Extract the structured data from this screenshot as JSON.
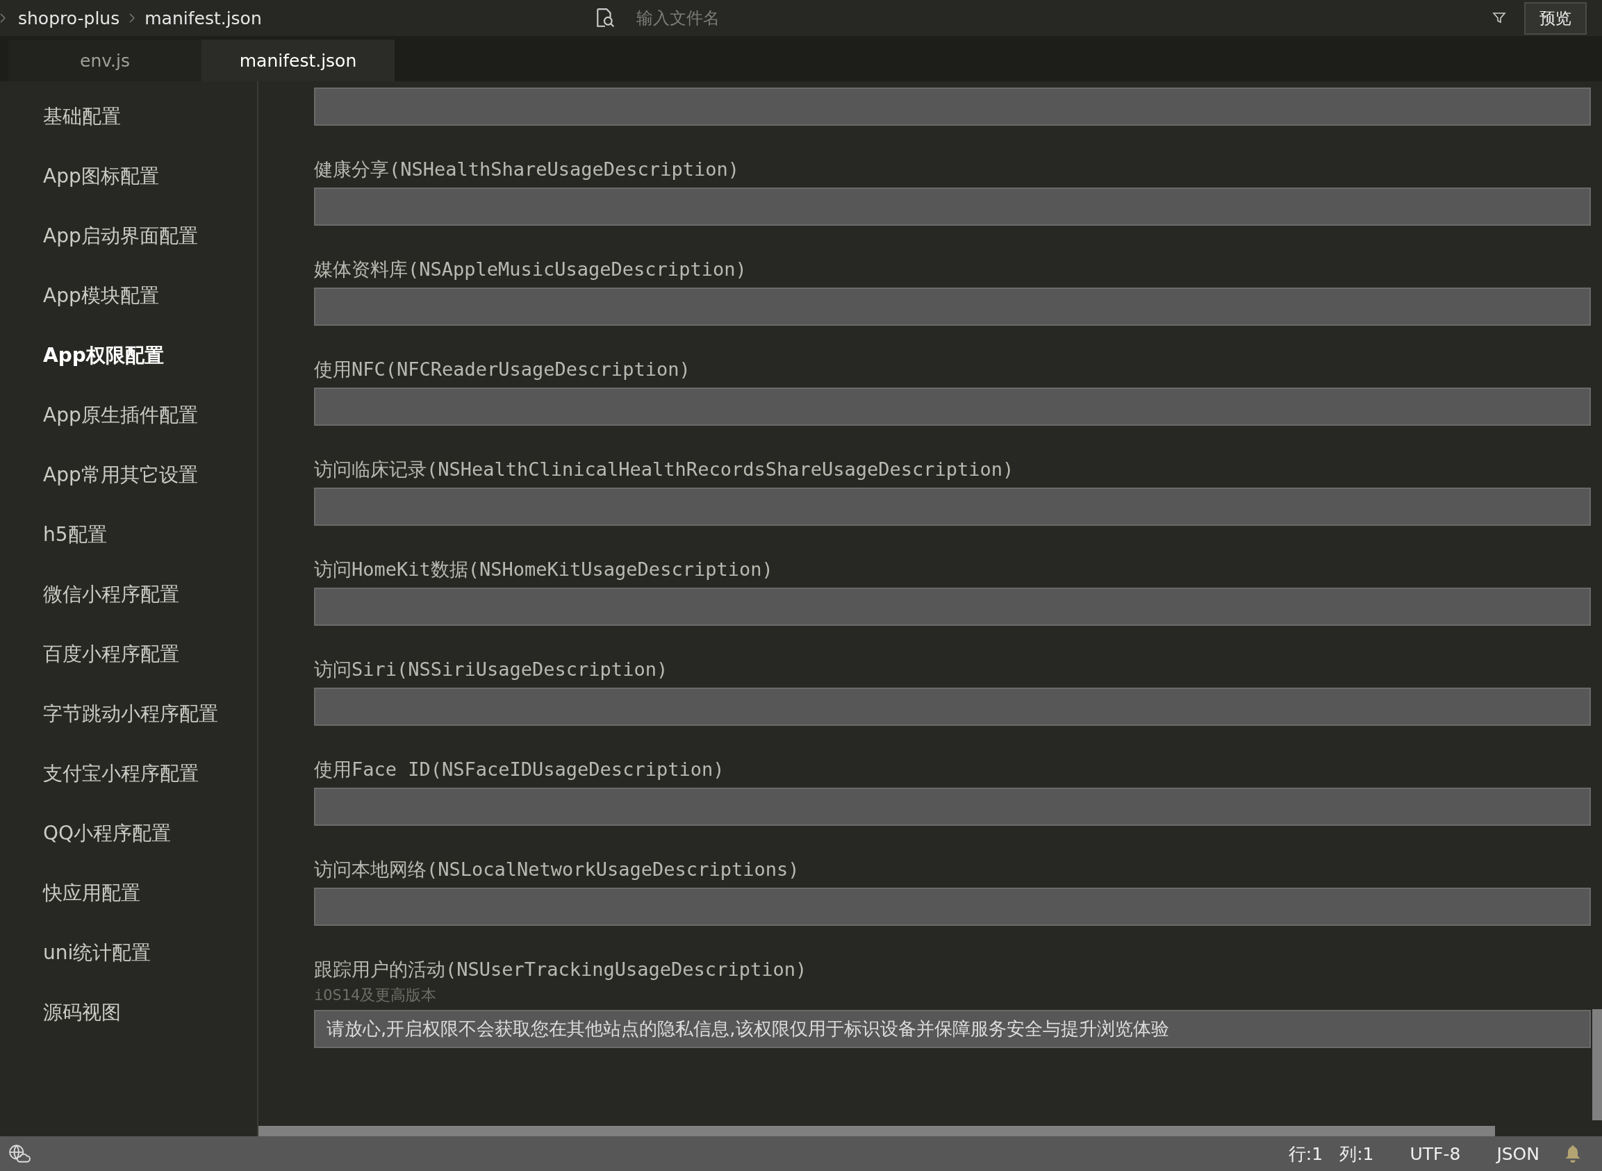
{
  "breadcrumb": [
    "shopro-plus",
    "manifest.json"
  ],
  "search": {
    "placeholder": "输入文件名"
  },
  "preview_button": "预览",
  "tabs": [
    {
      "label": "env.js",
      "selected": false
    },
    {
      "label": "manifest.json",
      "selected": true
    }
  ],
  "sidebar": {
    "items": [
      {
        "label": "基础配置",
        "selected": false
      },
      {
        "label": "App图标配置",
        "selected": false
      },
      {
        "label": "App启动界面配置",
        "selected": false
      },
      {
        "label": "App模块配置",
        "selected": false
      },
      {
        "label": "App权限配置",
        "selected": true
      },
      {
        "label": "App原生插件配置",
        "selected": false
      },
      {
        "label": "App常用其它设置",
        "selected": false
      },
      {
        "label": "h5配置",
        "selected": false
      },
      {
        "label": "微信小程序配置",
        "selected": false
      },
      {
        "label": "百度小程序配置",
        "selected": false
      },
      {
        "label": "字节跳动小程序配置",
        "selected": false
      },
      {
        "label": "支付宝小程序配置",
        "selected": false
      },
      {
        "label": "QQ小程序配置",
        "selected": false
      },
      {
        "label": "快应用配置",
        "selected": false
      },
      {
        "label": "uni统计配置",
        "selected": false
      },
      {
        "label": "源码视图",
        "selected": false
      }
    ]
  },
  "fields": [
    {
      "kind": "cut"
    },
    {
      "label": "健康分享(NSHealthShareUsageDescription)"
    },
    {
      "label": "媒体资料库(NSAppleMusicUsageDescription)"
    },
    {
      "label": "使用NFC(NFCReaderUsageDescription)"
    },
    {
      "label": "访问临床记录(NSHealthClinicalHealthRecordsShareUsageDescription)"
    },
    {
      "label": "访问HomeKit数据(NSHomeKitUsageDescription)"
    },
    {
      "label": "访问Siri(NSSiriUsageDescription)"
    },
    {
      "label": "使用Face ID(NSFaceIDUsageDescription)"
    },
    {
      "label": "访问本地网络(NSLocalNetworkUsageDescriptions)"
    },
    {
      "label": "跟踪用户的活动(NSUserTrackingUsageDescription)",
      "hint": "iOS14及更高版本",
      "value": "请放心,开启权限不会获取您在其他站点的隐私信息,该权限仅用于标识设备并保障服务安全与提升浏览体验"
    }
  ],
  "status_bar": {
    "position": [
      "行:1",
      "列:1"
    ],
    "encoding": "UTF-8",
    "language": "JSON"
  }
}
